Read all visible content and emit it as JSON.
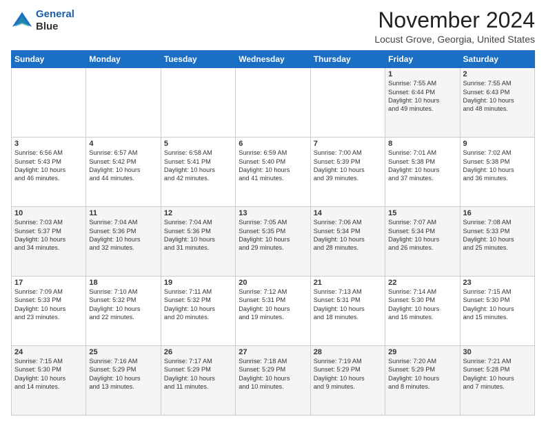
{
  "header": {
    "logo_line1": "General",
    "logo_line2": "Blue",
    "title": "November 2024",
    "subtitle": "Locust Grove, Georgia, United States"
  },
  "weekdays": [
    "Sunday",
    "Monday",
    "Tuesday",
    "Wednesday",
    "Thursday",
    "Friday",
    "Saturday"
  ],
  "weeks": [
    [
      {
        "day": "",
        "info": ""
      },
      {
        "day": "",
        "info": ""
      },
      {
        "day": "",
        "info": ""
      },
      {
        "day": "",
        "info": ""
      },
      {
        "day": "",
        "info": ""
      },
      {
        "day": "1",
        "info": "Sunrise: 7:55 AM\nSunset: 6:44 PM\nDaylight: 10 hours\nand 49 minutes."
      },
      {
        "day": "2",
        "info": "Sunrise: 7:55 AM\nSunset: 6:43 PM\nDaylight: 10 hours\nand 48 minutes."
      }
    ],
    [
      {
        "day": "3",
        "info": "Sunrise: 6:56 AM\nSunset: 5:43 PM\nDaylight: 10 hours\nand 46 minutes."
      },
      {
        "day": "4",
        "info": "Sunrise: 6:57 AM\nSunset: 5:42 PM\nDaylight: 10 hours\nand 44 minutes."
      },
      {
        "day": "5",
        "info": "Sunrise: 6:58 AM\nSunset: 5:41 PM\nDaylight: 10 hours\nand 42 minutes."
      },
      {
        "day": "6",
        "info": "Sunrise: 6:59 AM\nSunset: 5:40 PM\nDaylight: 10 hours\nand 41 minutes."
      },
      {
        "day": "7",
        "info": "Sunrise: 7:00 AM\nSunset: 5:39 PM\nDaylight: 10 hours\nand 39 minutes."
      },
      {
        "day": "8",
        "info": "Sunrise: 7:01 AM\nSunset: 5:38 PM\nDaylight: 10 hours\nand 37 minutes."
      },
      {
        "day": "9",
        "info": "Sunrise: 7:02 AM\nSunset: 5:38 PM\nDaylight: 10 hours\nand 36 minutes."
      }
    ],
    [
      {
        "day": "10",
        "info": "Sunrise: 7:03 AM\nSunset: 5:37 PM\nDaylight: 10 hours\nand 34 minutes."
      },
      {
        "day": "11",
        "info": "Sunrise: 7:04 AM\nSunset: 5:36 PM\nDaylight: 10 hours\nand 32 minutes."
      },
      {
        "day": "12",
        "info": "Sunrise: 7:04 AM\nSunset: 5:36 PM\nDaylight: 10 hours\nand 31 minutes."
      },
      {
        "day": "13",
        "info": "Sunrise: 7:05 AM\nSunset: 5:35 PM\nDaylight: 10 hours\nand 29 minutes."
      },
      {
        "day": "14",
        "info": "Sunrise: 7:06 AM\nSunset: 5:34 PM\nDaylight: 10 hours\nand 28 minutes."
      },
      {
        "day": "15",
        "info": "Sunrise: 7:07 AM\nSunset: 5:34 PM\nDaylight: 10 hours\nand 26 minutes."
      },
      {
        "day": "16",
        "info": "Sunrise: 7:08 AM\nSunset: 5:33 PM\nDaylight: 10 hours\nand 25 minutes."
      }
    ],
    [
      {
        "day": "17",
        "info": "Sunrise: 7:09 AM\nSunset: 5:33 PM\nDaylight: 10 hours\nand 23 minutes."
      },
      {
        "day": "18",
        "info": "Sunrise: 7:10 AM\nSunset: 5:32 PM\nDaylight: 10 hours\nand 22 minutes."
      },
      {
        "day": "19",
        "info": "Sunrise: 7:11 AM\nSunset: 5:32 PM\nDaylight: 10 hours\nand 20 minutes."
      },
      {
        "day": "20",
        "info": "Sunrise: 7:12 AM\nSunset: 5:31 PM\nDaylight: 10 hours\nand 19 minutes."
      },
      {
        "day": "21",
        "info": "Sunrise: 7:13 AM\nSunset: 5:31 PM\nDaylight: 10 hours\nand 18 minutes."
      },
      {
        "day": "22",
        "info": "Sunrise: 7:14 AM\nSunset: 5:30 PM\nDaylight: 10 hours\nand 16 minutes."
      },
      {
        "day": "23",
        "info": "Sunrise: 7:15 AM\nSunset: 5:30 PM\nDaylight: 10 hours\nand 15 minutes."
      }
    ],
    [
      {
        "day": "24",
        "info": "Sunrise: 7:15 AM\nSunset: 5:30 PM\nDaylight: 10 hours\nand 14 minutes."
      },
      {
        "day": "25",
        "info": "Sunrise: 7:16 AM\nSunset: 5:29 PM\nDaylight: 10 hours\nand 13 minutes."
      },
      {
        "day": "26",
        "info": "Sunrise: 7:17 AM\nSunset: 5:29 PM\nDaylight: 10 hours\nand 11 minutes."
      },
      {
        "day": "27",
        "info": "Sunrise: 7:18 AM\nSunset: 5:29 PM\nDaylight: 10 hours\nand 10 minutes."
      },
      {
        "day": "28",
        "info": "Sunrise: 7:19 AM\nSunset: 5:29 PM\nDaylight: 10 hours\nand 9 minutes."
      },
      {
        "day": "29",
        "info": "Sunrise: 7:20 AM\nSunset: 5:29 PM\nDaylight: 10 hours\nand 8 minutes."
      },
      {
        "day": "30",
        "info": "Sunrise: 7:21 AM\nSunset: 5:28 PM\nDaylight: 10 hours\nand 7 minutes."
      }
    ]
  ]
}
